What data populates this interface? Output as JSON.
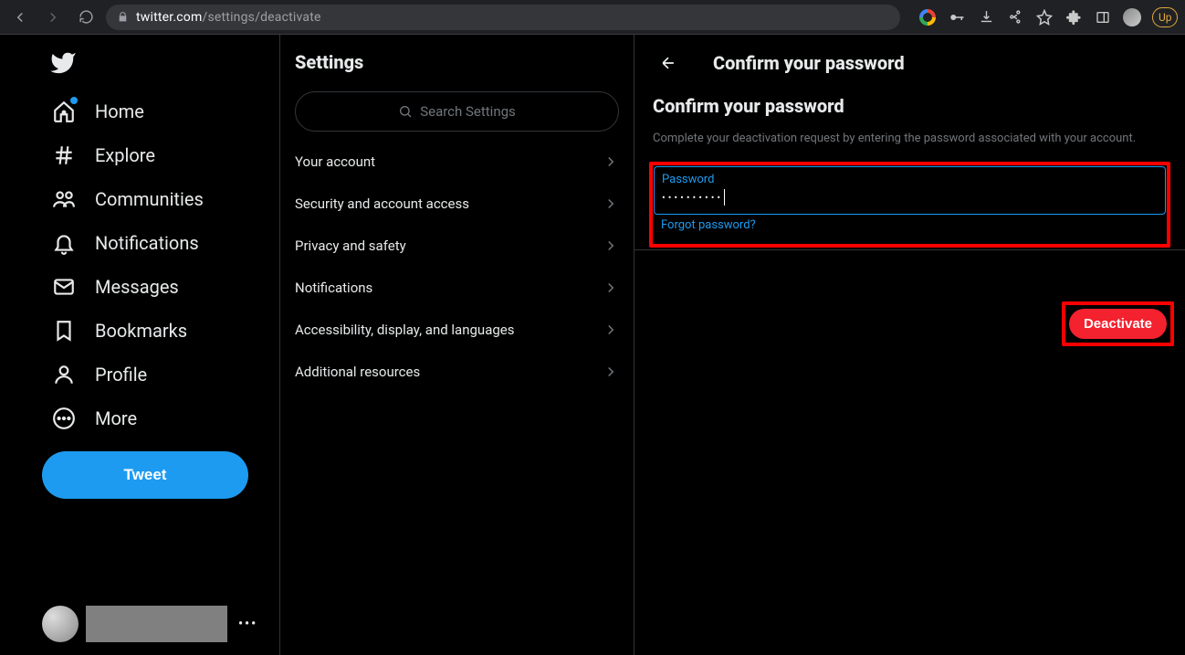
{
  "browser": {
    "url_domain": "twitter.com",
    "url_path": "/settings/deactivate",
    "update_label": "Up"
  },
  "sidebar": {
    "items": [
      {
        "label": "Home",
        "icon": "home-icon"
      },
      {
        "label": "Explore",
        "icon": "hash-icon"
      },
      {
        "label": "Communities",
        "icon": "communities-icon"
      },
      {
        "label": "Notifications",
        "icon": "bell-icon"
      },
      {
        "label": "Messages",
        "icon": "mail-icon"
      },
      {
        "label": "Bookmarks",
        "icon": "bookmark-icon"
      },
      {
        "label": "Profile",
        "icon": "profile-icon"
      },
      {
        "label": "More",
        "icon": "more-icon"
      }
    ],
    "tweet_label": "Tweet"
  },
  "settings": {
    "heading": "Settings",
    "search_placeholder": "Search Settings",
    "items": [
      {
        "label": "Your account"
      },
      {
        "label": "Security and account access"
      },
      {
        "label": "Privacy and safety"
      },
      {
        "label": "Notifications"
      },
      {
        "label": "Accessibility, display, and languages"
      },
      {
        "label": "Additional resources"
      }
    ]
  },
  "main": {
    "header_title": "Confirm your password",
    "subtitle": "Confirm your password",
    "description": "Complete your deactivation request by entering the password associated with your account.",
    "password_label": "Password",
    "password_value": "••••••••••",
    "forgot_label": "Forgot password?",
    "deactivate_label": "Deactivate"
  },
  "colors": {
    "accent": "#1d9bf0",
    "danger": "#f4212e",
    "highlight": "#ff0000"
  }
}
